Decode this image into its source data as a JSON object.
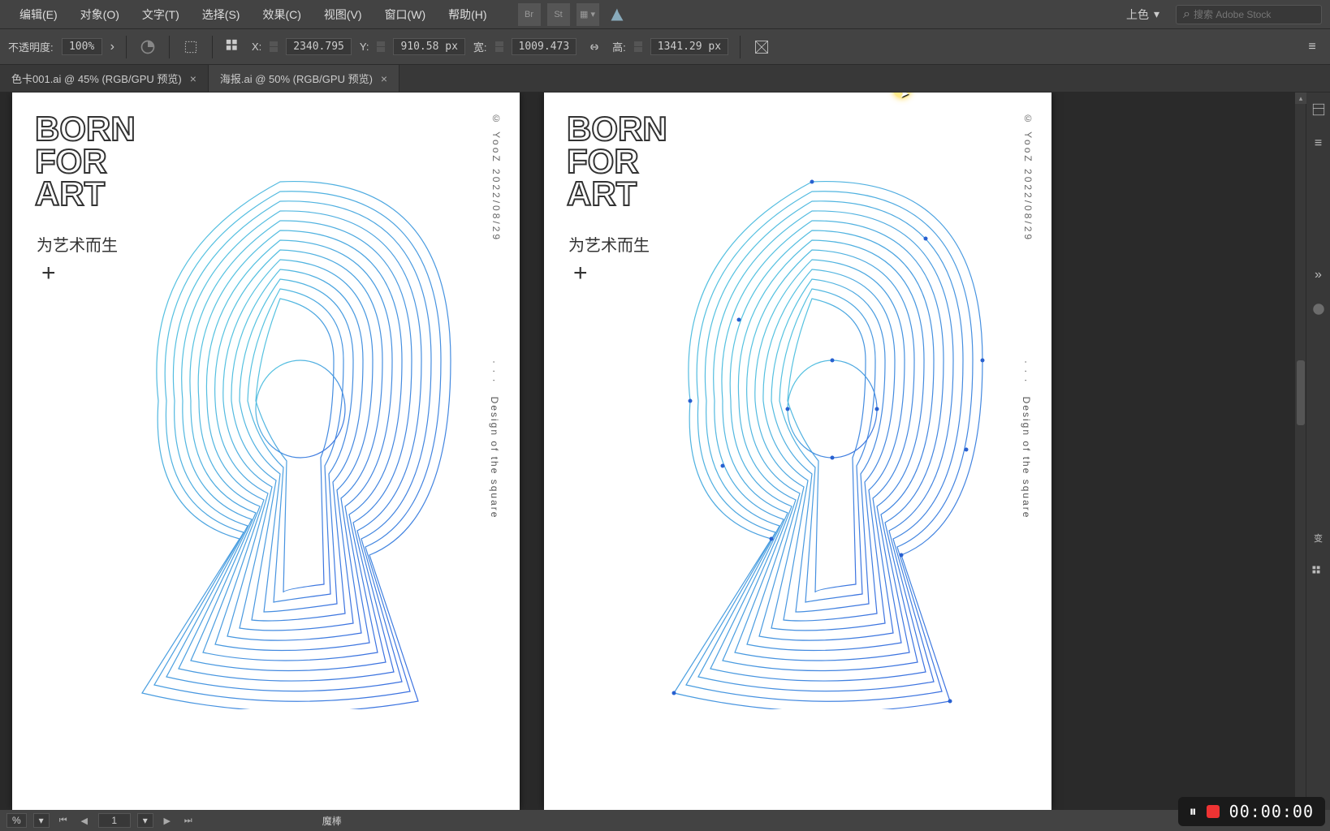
{
  "menu": {
    "edit": "编辑(E)",
    "object": "对象(O)",
    "text": "文字(T)",
    "select": "选择(S)",
    "effect": "效果(C)",
    "view": "视图(V)",
    "window": "窗口(W)",
    "help": "帮助(H)",
    "workspace_label": "上色",
    "search_placeholder": "搜索 Adobe Stock"
  },
  "control": {
    "opacity_label": "不透明度:",
    "opacity_value": "100%",
    "x_label": "X:",
    "x_value": "2340.795",
    "y_label": "Y:",
    "y_value": "910.58 px",
    "w_label": "宽:",
    "w_value": "1009.473",
    "h_label": "高:",
    "h_value": "1341.29 px"
  },
  "tabs": {
    "tab1": "色卡001.ai @ 45% (RGB/GPU 预览)",
    "tab2": "海报.ai @ 50% (RGB/GPU 预览)"
  },
  "poster": {
    "line1": "BORN",
    "line2": "FOR",
    "line3": "ART",
    "subtitle": "为艺术而生",
    "plus": "+",
    "copyright": "© YooZ  2022/08/29",
    "side_dots": "· · ·",
    "side_text": "Design of the square"
  },
  "status": {
    "zoom": "%",
    "page": "1",
    "tool": "魔棒"
  },
  "panels": {
    "transform_label": "变"
  },
  "recorder": {
    "time": "00:00:00"
  }
}
